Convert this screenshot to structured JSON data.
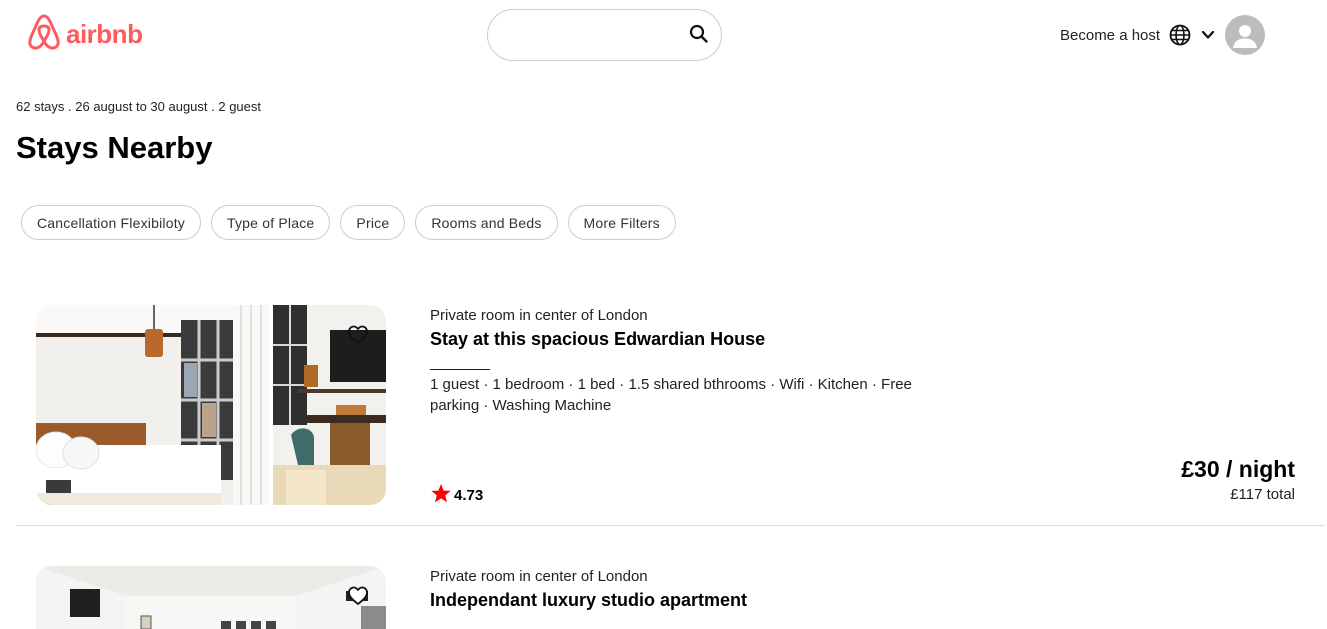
{
  "brand": {
    "name": "airbnb",
    "color": "#FF5A5F"
  },
  "search": {
    "value": "",
    "placeholder": ""
  },
  "header": {
    "become_host": "Become a host"
  },
  "summary": {
    "meta": "62 stays . 26 august to 30 august . 2 guest",
    "title": "Stays Nearby"
  },
  "filters": [
    "Cancellation Flexibiloty",
    "Type of Place",
    "Price",
    "Rooms and Beds",
    "More Filters"
  ],
  "listings": [
    {
      "subtitle": "Private room in center of London",
      "name": "Stay at this spacious Edwardian House",
      "amenities": "1 guest · 1 bedroom · 1 bed · 1.5 shared bthrooms · Wifi · Kitchen · Free parking · Washing Machine",
      "rating": "4.73",
      "price": "£30 / night",
      "total": "£117 total"
    },
    {
      "subtitle": "Private room in center of London",
      "name": "Independant luxury studio apartment"
    }
  ],
  "colors": {
    "star": "#FF0000",
    "border": "#cccccc"
  }
}
